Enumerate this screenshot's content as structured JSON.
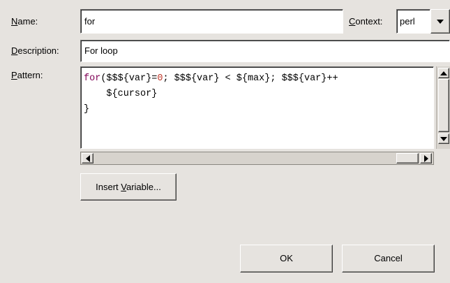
{
  "name": {
    "label_mnemonic": "N",
    "label_rest": "ame:",
    "value": "for"
  },
  "context": {
    "label_mnemonic": "C",
    "label_rest": "ontext:",
    "selected": "perl"
  },
  "description": {
    "label_mnemonic": "D",
    "label_rest": "escription:",
    "value": "For loop"
  },
  "pattern": {
    "label_mnemonic": "P",
    "label_rest": "attern:",
    "line1": {
      "keyword": "for",
      "a": "($$${var}=",
      "zero": "0",
      "b": "; $$${var} < ${max}; $$${var}++"
    },
    "line2": "    ${cursor}",
    "line3": "}"
  },
  "insert_variable": {
    "pre": "Insert ",
    "mnemonic": "V",
    "post": "ariable..."
  },
  "ok_label": "OK",
  "cancel_label": "Cancel",
  "colors": {
    "background": "#e6e3df",
    "keyword": "#7f0055",
    "number": "#c0392b"
  }
}
